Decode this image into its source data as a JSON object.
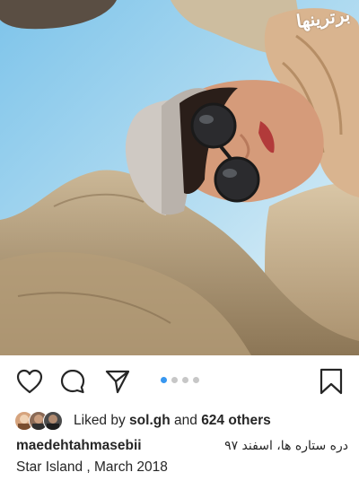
{
  "watermark": "برترینها",
  "carousel": {
    "count": 4,
    "active": 0
  },
  "likes": {
    "prefix": "Liked by",
    "user": "sol.gh",
    "connector": "and",
    "others": "624 others"
  },
  "caption": {
    "username": "maedehtahmasebii",
    "text_fa": "دره ستاره ها، اسفند ۹۷",
    "text_en": "Star Island , March 2018"
  },
  "colors": {
    "accent": "#3897f0",
    "text": "#262626",
    "dot_inactive": "#c7c7c7"
  },
  "icons": [
    "heart-icon",
    "comment-icon",
    "share-icon",
    "bookmark-icon"
  ]
}
